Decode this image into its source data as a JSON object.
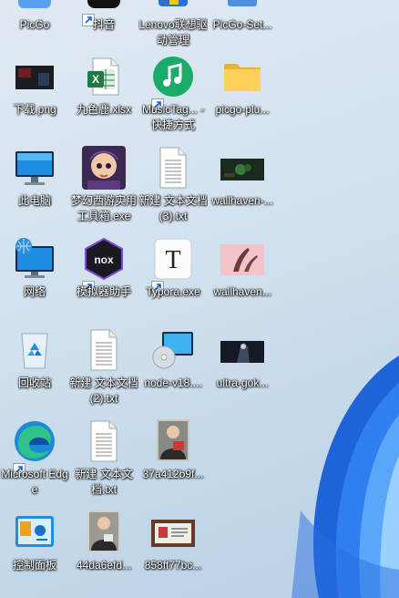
{
  "desktop": {
    "icons": [
      {
        "label": "PicGo",
        "icon": "picgo-app-icon"
      },
      {
        "label": "抖音",
        "icon": "douyin-app-icon"
      },
      {
        "label": "Lenovo联想驱动管理",
        "icon": "lenovo-driver-icon"
      },
      {
        "label": "PicGo-Set...",
        "icon": "installer-icon"
      },
      {
        "label": "下载.png",
        "icon": "image-file-icon"
      },
      {
        "label": "九色鹿.xlsx",
        "icon": "excel-file-icon"
      },
      {
        "label": "MusicTag... - 快捷方式",
        "icon": "music-tag-icon"
      },
      {
        "label": "picgo-plu...",
        "icon": "folder-icon"
      },
      {
        "label": "此电脑",
        "icon": "this-pc-icon"
      },
      {
        "label": "梦幻西游实用工具箱.exe",
        "icon": "game-toolbox-icon"
      },
      {
        "label": "新建 文本文档 (3).txt",
        "icon": "text-file-icon"
      },
      {
        "label": "wallhaven-...",
        "icon": "wallpaper-image-icon"
      },
      {
        "label": "网络",
        "icon": "network-icon"
      },
      {
        "label": "模拟器助手",
        "icon": "nox-emulator-icon"
      },
      {
        "label": "Typora.exe",
        "icon": "typora-icon"
      },
      {
        "label": "wallhaven...",
        "icon": "wallpaper-image-icon"
      },
      {
        "label": "回收站",
        "icon": "recycle-bin-icon"
      },
      {
        "label": "新建 文本文档 (2).txt",
        "icon": "text-file-icon"
      },
      {
        "label": "node-v18....",
        "icon": "msi-installer-icon"
      },
      {
        "label": "ultra-gok...",
        "icon": "wallpaper-image-icon"
      },
      {
        "label": "Microsoft Edge",
        "icon": "edge-icon"
      },
      {
        "label": "新建 文本文档.txt",
        "icon": "text-file-icon"
      },
      {
        "label": "37a412b9f...",
        "icon": "photo-image-icon"
      },
      {
        "label": "控制面板",
        "icon": "control-panel-icon"
      },
      {
        "label": "44da6efd...",
        "icon": "photo-image-icon"
      },
      {
        "label": "858ff77bc...",
        "icon": "photo-image-icon"
      }
    ]
  }
}
